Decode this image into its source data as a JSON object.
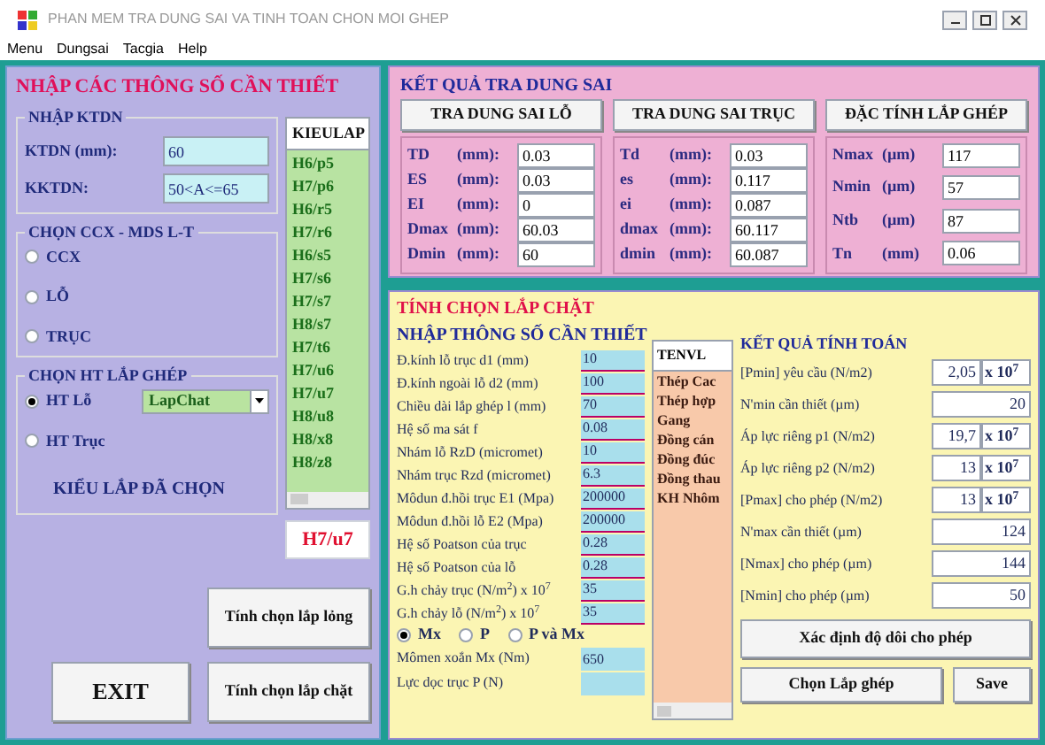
{
  "window": {
    "title": "PHAN MEM TRA DUNG SAI VA TINH TOAN CHON MOI GHEP"
  },
  "menu": [
    "Menu",
    "Dungsai",
    "Tacgia",
    "Help"
  ],
  "input_panel": {
    "title": "NHẬP CÁC THÔNG SỐ CẦN THIẾT",
    "ktdn": {
      "title": "NHẬP KTDN",
      "fields": [
        {
          "label": "KTDN (mm):",
          "value": "60"
        },
        {
          "label": "KKTDN:",
          "value": "50<A<=65"
        }
      ]
    },
    "kieulap": {
      "header": "KIEULAP",
      "items": [
        "H6/p5",
        "H7/p6",
        "H6/r5",
        "H7/r6",
        "H6/s5",
        "H7/s6",
        "H7/s7",
        "H8/s7",
        "H7/t6",
        "H7/u6",
        "H7/u7",
        "H8/u8",
        "H8/x8",
        "H8/z8"
      ]
    },
    "ccx": {
      "title": "CHỌN CCX - MDS L-T",
      "options": [
        {
          "label": "CCX",
          "selected": false
        },
        {
          "label": "LỖ",
          "selected": false
        },
        {
          "label": "TRỤC",
          "selected": false
        }
      ]
    },
    "ht": {
      "title": "CHỌN HT LẮP GHÉP",
      "options": [
        {
          "label": "HT Lỗ",
          "selected": true
        },
        {
          "label": "HT Trục",
          "selected": false
        }
      ],
      "dropdown": "LapChat"
    },
    "chosen": {
      "label": "KIỂU LẮP ĐÃ CHỌN",
      "value": "H7/u7"
    },
    "buttons": {
      "loose": "Tính chọn lắp lỏng",
      "exit": "EXIT",
      "tight": "Tính chọn lắp chặt"
    }
  },
  "results_panel": {
    "title": "KẾT QUẢ TRA DUNG SAI",
    "groups": [
      {
        "header": "TRA DUNG SAI LỖ",
        "rows": [
          {
            "name": "TD",
            "unit": "(mm):",
            "value": "0.03"
          },
          {
            "name": "ES",
            "unit": "(mm):",
            "value": "0.03"
          },
          {
            "name": "EI",
            "unit": "(mm):",
            "value": "0"
          },
          {
            "name": "Dmax",
            "unit": "(mm):",
            "value": "60.03"
          },
          {
            "name": "Dmin",
            "unit": "(mm):",
            "value": "60"
          }
        ]
      },
      {
        "header": "TRA DUNG SAI TRỤC",
        "rows": [
          {
            "name": "Td",
            "unit": "(mm):",
            "value": "0.03"
          },
          {
            "name": "es",
            "unit": "(mm):",
            "value": "0.117"
          },
          {
            "name": "ei",
            "unit": "(mm):",
            "value": "0.087"
          },
          {
            "name": "dmax",
            "unit": "(mm):",
            "value": "60.117"
          },
          {
            "name": "dmin",
            "unit": "(mm):",
            "value": "60.087"
          }
        ]
      },
      {
        "header": "ĐẶC TÍNH LẮP GHÉP",
        "rows": [
          {
            "name": "Nmax",
            "unit": "(µm)",
            "value": "117"
          },
          {
            "name": "Nmin",
            "unit": "(µm)",
            "value": "57"
          },
          {
            "name": "Ntb",
            "unit": "(µm)",
            "value": "87"
          },
          {
            "name": "Tn",
            "unit": "(mm)",
            "value": "0.06"
          }
        ]
      }
    ]
  },
  "tight_panel": {
    "title": "TÍNH CHỌN LẮP CHẶT",
    "inputs_title": "NHẬP THÔNG SỐ CẦN THIẾT",
    "params": [
      {
        "label": "Đ.kính lỗ trục d1 (mm)",
        "value": "10"
      },
      {
        "label": "Đ.kính ngoài lỗ d2 (mm)",
        "value": "100"
      },
      {
        "label": "Chiều dài lắp ghép l (mm)",
        "value": "70"
      },
      {
        "label": "Hệ số ma sát f",
        "value": "0.08"
      },
      {
        "label": "Nhám lỗ RzD (micromet)",
        "value": "10"
      },
      {
        "label": "Nhám trục Rzd (micromet)",
        "value": "6.3"
      },
      {
        "label": "Môdun đ.hồi trục E1 (Mpa)",
        "value": "200000"
      },
      {
        "label": "Môdun đ.hồi lỗ E2 (Mpa)",
        "value": "200000"
      },
      {
        "label": "Hệ số Poatson của trục",
        "value": "0.28"
      },
      {
        "label": "Hệ số Poatson của lỗ",
        "value": "0.28"
      },
      {
        "label": "G.h chảy trục (N/m$^{2}$) x 10$^{7}$",
        "value": "35"
      },
      {
        "label": "G.h chảy lỗ (N/m$^{2}$) x 10$^{7}$",
        "value": "35"
      }
    ],
    "load_options": [
      {
        "label": "Mx",
        "selected": true
      },
      {
        "label": "P",
        "selected": false
      },
      {
        "label": "P và Mx",
        "selected": false
      }
    ],
    "loads": [
      {
        "label": "Mômen xoắn Mx (Nm)",
        "value": "650"
      },
      {
        "label": "Lực dọc trục P (N)"
      }
    ],
    "materials": {
      "header": "TENVL",
      "items": [
        "Thép Cac",
        "Thép hợp",
        "Gang",
        "Đồng cán",
        "Đồng đúc",
        "Đồng thau",
        "KH Nhôm"
      ]
    },
    "results_title": "KẾT QUẢ TÍNH TOÁN",
    "results": [
      {
        "kind": "sci",
        "label": "[Pmin] yêu cầu (N/m2)",
        "value": "2,05",
        "exponent": "x 10$^{7}$"
      },
      {
        "kind": "plain",
        "label": "N'min cần thiết (µm)",
        "value": "20"
      },
      {
        "kind": "sci",
        "label": "Áp lực riêng p1 (N/m2)",
        "value": "19,7",
        "exponent": "x 10$^{7}$"
      },
      {
        "kind": "sci",
        "label": "Áp lực riêng p2 (N/m2)",
        "value": "13",
        "exponent": "x 10$^{7}$"
      },
      {
        "kind": "sci",
        "label": "[Pmax] cho phép (N/m2)",
        "value": "13",
        "exponent": "x 10$^{7}$"
      },
      {
        "kind": "plain",
        "label": "N'max cần thiết (µm)",
        "value": "124"
      },
      {
        "kind": "plain",
        "label": "[Nmax] cho phép (µm)",
        "value": "144"
      },
      {
        "kind": "plain",
        "label": "[Nmin] cho phép (µm)",
        "value": "50"
      }
    ],
    "buttons": {
      "allow": "Xác định độ dôi cho phép",
      "choose": "Chọn Lắp ghép",
      "save": "Save"
    }
  }
}
